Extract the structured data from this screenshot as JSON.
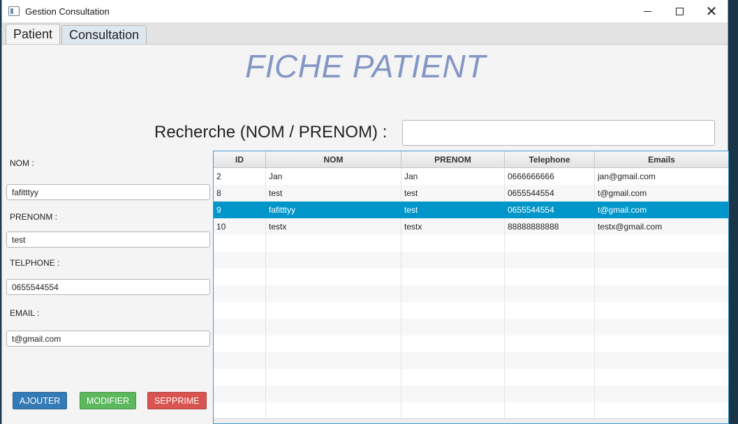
{
  "window": {
    "title": "Gestion Consultation",
    "minimize_icon": "minimize-icon",
    "maximize_icon": "maximize-icon",
    "close_icon": "close-icon",
    "close_glyph": "✕"
  },
  "tabs": [
    {
      "label": "Patient",
      "active": true
    },
    {
      "label": "Consultation",
      "active": false
    }
  ],
  "page": {
    "heading": "FICHE PATIENT",
    "search_label": "Recherche (NOM / PRENOM) :",
    "search_value": ""
  },
  "form": {
    "nom_label": "NOM :",
    "nom_value": "fafitttyy",
    "prenom_label": "PRENONM :",
    "prenom_value": "test",
    "telephone_label": "TELPHONE :",
    "telephone_value": "0655544554",
    "email_label": "EMAIL :",
    "email_value": "t@gmail.com"
  },
  "buttons": {
    "add": "AJOUTER",
    "edit": "MODIFIER",
    "delete": "SEPPRIME"
  },
  "table": {
    "columns": [
      "ID",
      "NOM",
      "PRENOM",
      "Telephone",
      "Emails"
    ],
    "rows": [
      [
        "2",
        "Jan",
        "Jan",
        "0666666666",
        "jan@gmail.com"
      ],
      [
        "8",
        "test",
        "test",
        "0655544554",
        "t@gmail.com"
      ],
      [
        "9",
        "fafitttyy",
        "test",
        "0655544554",
        "t@gmail.com"
      ],
      [
        "10",
        "testx",
        "testx",
        "88888888888",
        "testx@gmail.com"
      ]
    ],
    "selected_row": 2,
    "empty_rows": 11
  },
  "colors": {
    "heading": "#8496c6",
    "selection": "#0096c9",
    "add_button": "#337ab7",
    "edit_button": "#5cb85c",
    "delete_button": "#d9534f"
  }
}
